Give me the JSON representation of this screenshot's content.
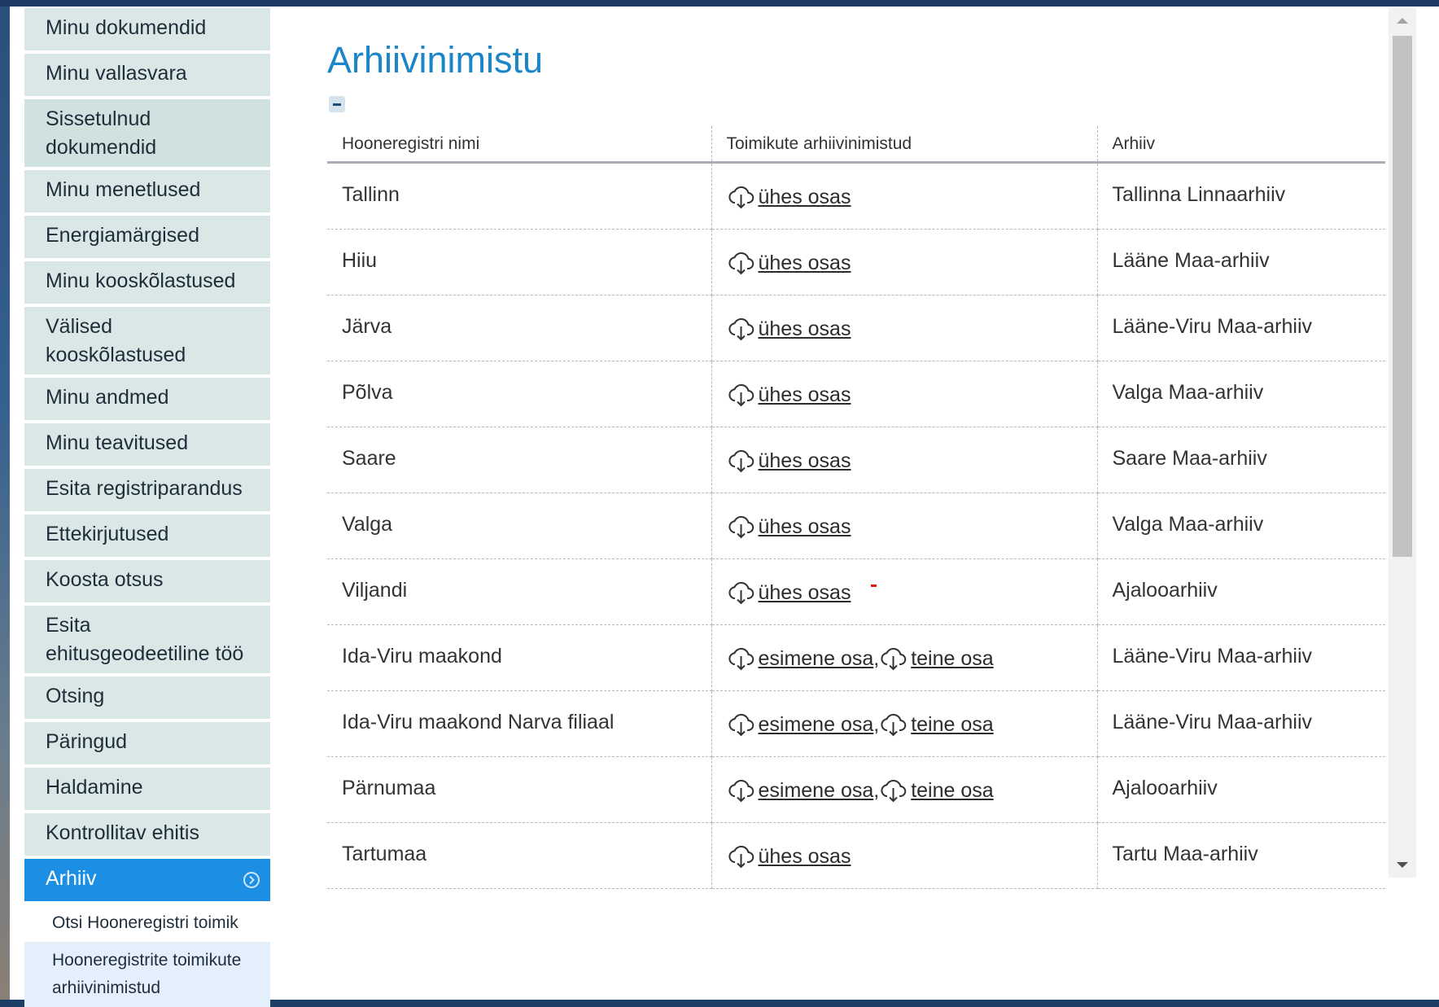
{
  "sidebar": {
    "items": [
      {
        "label": "Minu dokumendid"
      },
      {
        "label": "Minu vallasvara"
      },
      {
        "label": "Sissetulnud dokumendid"
      },
      {
        "label": "Minu menetlused"
      },
      {
        "label": "Energiamärgised"
      },
      {
        "label": "Minu kooskõlastused"
      },
      {
        "label": "Välised kooskõlastused"
      },
      {
        "label": "Minu andmed"
      },
      {
        "label": "Minu teavitused"
      },
      {
        "label": "Esita registriparandus"
      },
      {
        "label": "Ettekirjutused"
      },
      {
        "label": "Koosta otsus"
      },
      {
        "label": "Esita ehitusgeodeetiline töö"
      },
      {
        "label": "Otsing"
      },
      {
        "label": "Päringud"
      },
      {
        "label": "Haldamine"
      },
      {
        "label": "Kontrollitav ehitis"
      },
      {
        "label": "Arhiiv"
      }
    ],
    "subitems": [
      {
        "label": "Otsi Hooneregistri toimik"
      },
      {
        "label": "Hooneregistrite toimikute arhiivinimistud"
      }
    ]
  },
  "main": {
    "title": "Arhiivinimistu",
    "table": {
      "headers": [
        "Hooneregistri nimi",
        "Toimikute arhiivinimistud",
        "Arhiiv"
      ],
      "rows": [
        {
          "name": "Tallinn",
          "links": [
            "ühes osas"
          ],
          "archive": "Tallinna Linnaarhiiv"
        },
        {
          "name": "Hiiu",
          "links": [
            "ühes osas"
          ],
          "archive": "Lääne Maa-arhiiv"
        },
        {
          "name": "Järva",
          "links": [
            "ühes osas"
          ],
          "archive": "Lääne-Viru Maa-arhiiv"
        },
        {
          "name": "Põlva",
          "links": [
            "ühes osas"
          ],
          "archive": "Valga Maa-arhiiv"
        },
        {
          "name": "Saare",
          "links": [
            "ühes osas"
          ],
          "archive": "Saare Maa-arhiiv"
        },
        {
          "name": "Valga",
          "links": [
            "ühes osas"
          ],
          "archive": "Valga Maa-arhiiv"
        },
        {
          "name": "Viljandi",
          "links": [
            "ühes osas"
          ],
          "archive": "Ajalooarhiiv"
        },
        {
          "name": "Ida-Viru maakond",
          "links": [
            "esimene osa",
            "teine osa"
          ],
          "archive": "Lääne-Viru Maa-arhiiv"
        },
        {
          "name": "Ida-Viru maakond Narva filiaal",
          "links": [
            "esimene osa",
            "teine osa"
          ],
          "archive": "Lääne-Viru Maa-arhiiv"
        },
        {
          "name": "Pärnumaa",
          "links": [
            "esimene osa",
            "teine osa"
          ],
          "archive": "Ajalooarhiiv"
        },
        {
          "name": "Tartumaa",
          "links": [
            "ühes osas"
          ],
          "archive": "Tartu Maa-arhiiv"
        }
      ],
      "link_separator": ","
    }
  },
  "icons": {
    "download": "cloud-download-icon",
    "collapse": "minus-icon",
    "nav_active": "chevron-right-circle-icon"
  },
  "colors": {
    "accent": "#1c8ee4",
    "title": "#1b86c7",
    "nav_bg": "#d9e8e6"
  }
}
